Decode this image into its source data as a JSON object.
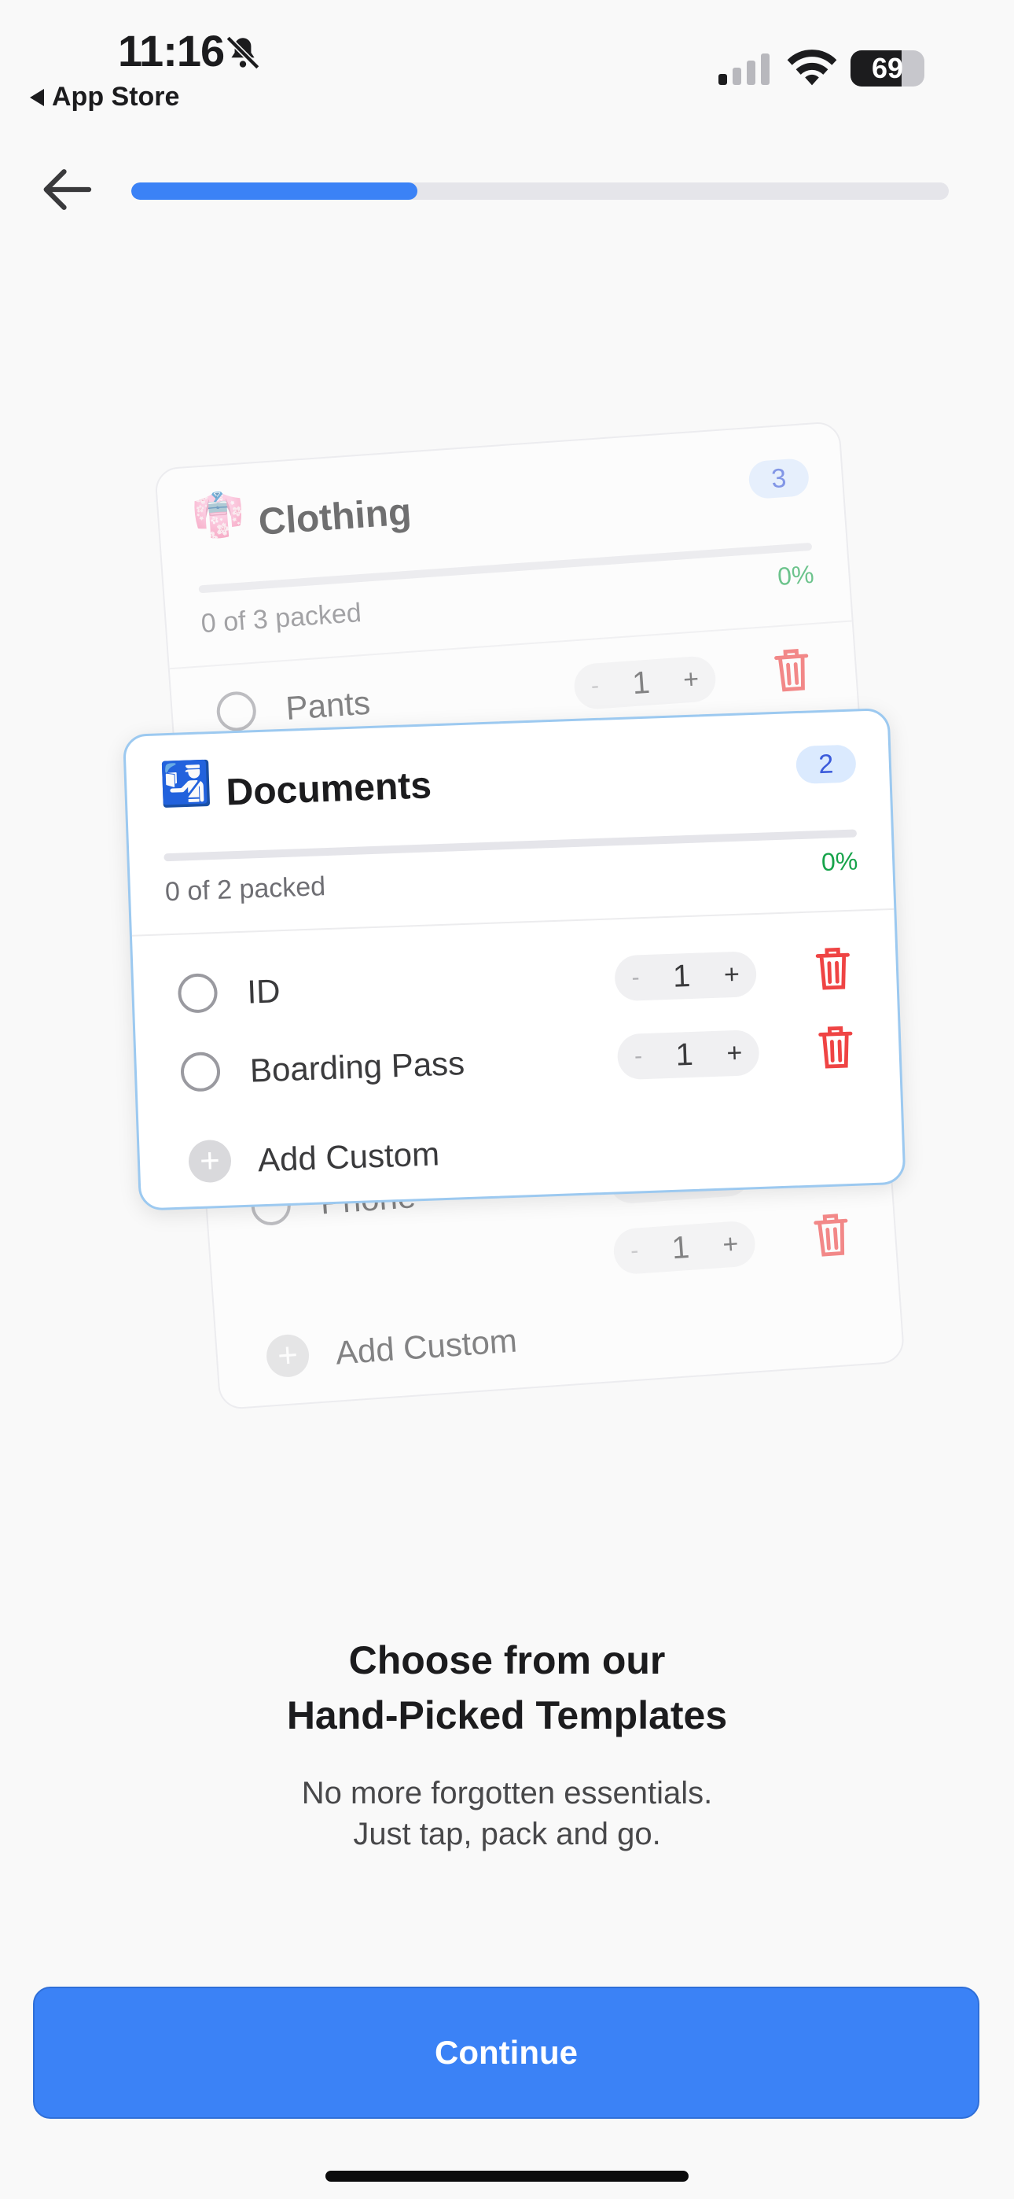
{
  "status": {
    "time": "11:16",
    "back_app": "App Store",
    "battery": "69",
    "battery_level": 0.69
  },
  "onboarding": {
    "progress": 0.35
  },
  "cards": {
    "clothing": {
      "emoji": "👘",
      "title": "Clothing",
      "count": "3",
      "packed": "0 of 3 packed",
      "percent": "0%",
      "items": [
        {
          "name": "Pants",
          "qty": "1"
        },
        {
          "name": "",
          "qty": "1"
        },
        {
          "name": "Phone",
          "qty": "1"
        },
        {
          "name": "",
          "qty": "1"
        }
      ],
      "add_label": "Add Custom"
    },
    "documents": {
      "emoji": "🛂",
      "title": "Documents",
      "count": "2",
      "packed": "0 of 2 packed",
      "percent": "0%",
      "items": [
        {
          "name": "ID",
          "qty": "1"
        },
        {
          "name": "Boarding Pass",
          "qty": "1"
        }
      ],
      "add_label": "Add Custom"
    },
    "stepper": {
      "minus": "-",
      "plus": "+"
    }
  },
  "headline": {
    "line1": "Choose from our",
    "line2": "Hand-Picked Templates"
  },
  "subline": {
    "line1": "No more forgotten essentials.",
    "line2": "Just tap, pack and go."
  },
  "continue_label": "Continue",
  "colors": {
    "accent": "#3b82f6",
    "delete": "#ef4444",
    "percent": "#16a34a"
  }
}
